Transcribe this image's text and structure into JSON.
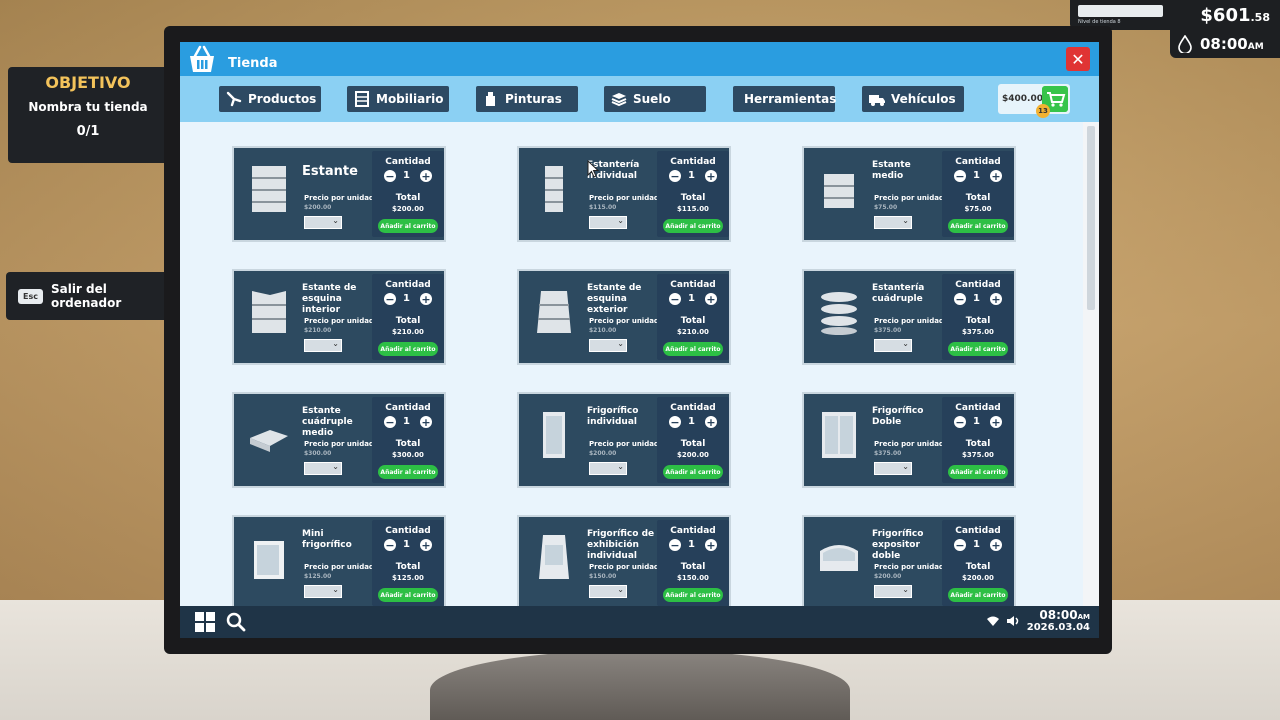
{
  "hud": {
    "level_label": "Nivel de tienda 8",
    "level_progress": 0.0,
    "money": "$601",
    "money_cents": ".58",
    "time": "08:00",
    "time_suffix": "AM"
  },
  "objective": {
    "title": "OBJETIVO",
    "text": "Nombra tu tienda",
    "count": "0/1"
  },
  "exit": {
    "key": "Esc",
    "label": "Salir del ordenador"
  },
  "window": {
    "title": "Tienda",
    "close": "✕"
  },
  "tabs": [
    {
      "label": "Productos",
      "icon": "hand-icon"
    },
    {
      "label": "Mobiliario",
      "icon": "furniture-icon"
    },
    {
      "label": "Pinturas",
      "icon": "paint-icon"
    },
    {
      "label": "Suelo",
      "icon": "floor-icon"
    },
    {
      "label": "Herramientas",
      "icon": "tools-icon"
    },
    {
      "label": "Vehículos",
      "icon": "truck-icon"
    }
  ],
  "cart": {
    "price": "$400.00",
    "badge": "13"
  },
  "card_labels": {
    "quantity": "Cantidad",
    "unit_price": "Precio por unidad",
    "total": "Total",
    "add_to_cart": "Añadir al carrito"
  },
  "items": [
    {
      "name": "Estante",
      "unit_price": "$200.00",
      "qty": "1",
      "total": "$200.00",
      "big": true
    },
    {
      "name": "Estantería individual",
      "unit_price": "$115.00",
      "qty": "1",
      "total": "$115.00",
      "big": false
    },
    {
      "name": "Estante medio",
      "unit_price": "$75.00",
      "qty": "1",
      "total": "$75.00",
      "big": false
    },
    {
      "name": "Estante de esquina interior",
      "unit_price": "$210.00",
      "qty": "1",
      "total": "$210.00",
      "big": false
    },
    {
      "name": "Estante de esquina exterior",
      "unit_price": "$210.00",
      "qty": "1",
      "total": "$210.00",
      "big": false
    },
    {
      "name": "Estantería cuádruple",
      "unit_price": "$375.00",
      "qty": "1",
      "total": "$375.00",
      "big": false
    },
    {
      "name": "Estante cuádruple medio",
      "unit_price": "$300.00",
      "qty": "1",
      "total": "$300.00",
      "big": false
    },
    {
      "name": "Frigorífico individual",
      "unit_price": "$200.00",
      "qty": "1",
      "total": "$200.00",
      "big": false
    },
    {
      "name": "Frigorífico Doble",
      "unit_price": "$375.00",
      "qty": "1",
      "total": "$375.00",
      "big": false
    },
    {
      "name": "Mini frigorífico",
      "unit_price": "$125.00",
      "qty": "1",
      "total": "$125.00",
      "big": false
    },
    {
      "name": "Frigorífico de exhibición individual",
      "unit_price": "$150.00",
      "qty": "1",
      "total": "$150.00",
      "big": false
    },
    {
      "name": "Frigorífico expositor doble",
      "unit_price": "$200.00",
      "qty": "1",
      "total": "$200.00",
      "big": false
    }
  ],
  "taskbar": {
    "time": "08:00",
    "time_suffix": "AM",
    "date": "2026.03.04"
  }
}
